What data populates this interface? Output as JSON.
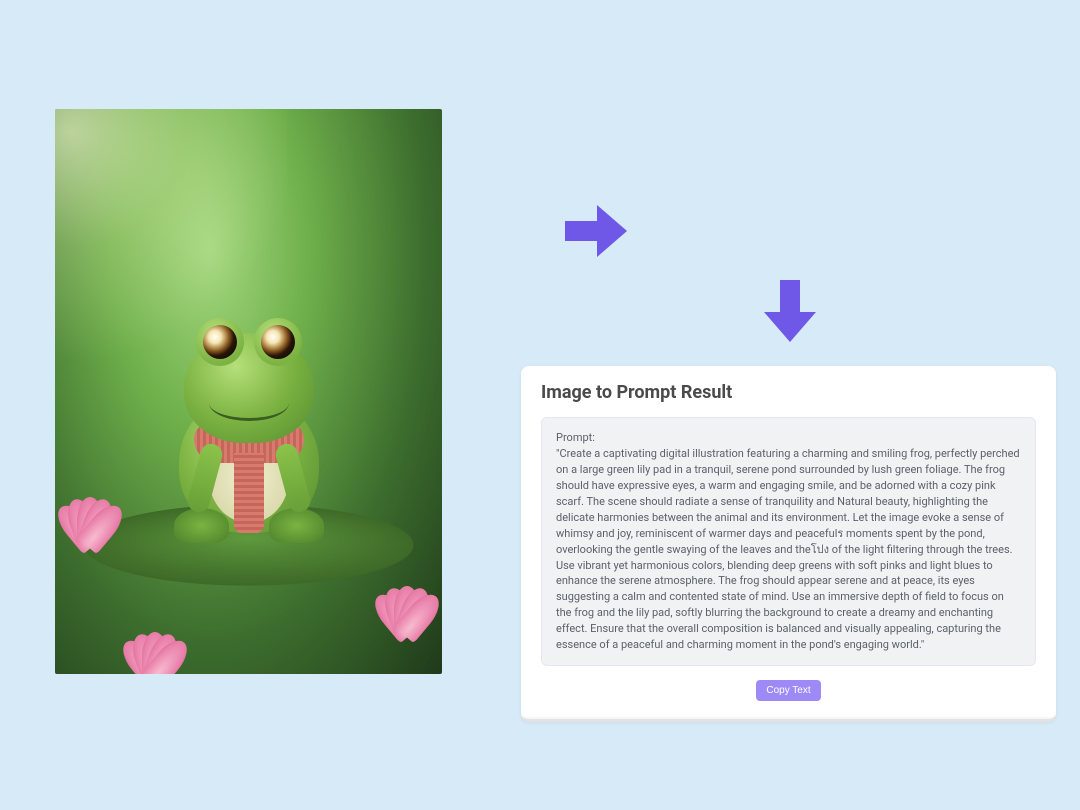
{
  "image": {
    "description": "frog-on-lilypad-illustration"
  },
  "arrows": {
    "color": "#6f57e7"
  },
  "result": {
    "title": "Image to Prompt Result",
    "prompt_label": "Prompt:",
    "prompt_text": "\"Create a captivating digital illustration featuring a charming and smiling frog, perfectly perched on a large green lily pad in a tranquil, serene pond surrounded by lush green foliage. The frog should have expressive eyes, a warm and engaging smile, and be adorned with a cozy pink scarf. The scene should radiate a sense of tranquility and Natural beauty, highlighting the delicate harmonies between the animal and its environment. Let the image evoke a sense of whimsy and joy, reminiscent of warmer days and peacefulร moments spent by the pond, overlooking the gentle swaying of the leaves and theโปง of the light filtering through the trees. Use vibrant yet harmonious colors, blending deep greens with soft pinks and light blues to enhance the serene atmosphere. The frog should appear serene and at peace, its eyes suggesting a calm and contented state of mind. Use an immersive depth of field to focus on the frog and the lily pad, softly blurring the background to create a dreamy and enchanting effect. Ensure that the overall composition is balanced and visually appealing, capturing the essence of a peaceful and charming moment in the pond's engaging world.\"",
    "copy_button_label": "Copy Text"
  }
}
